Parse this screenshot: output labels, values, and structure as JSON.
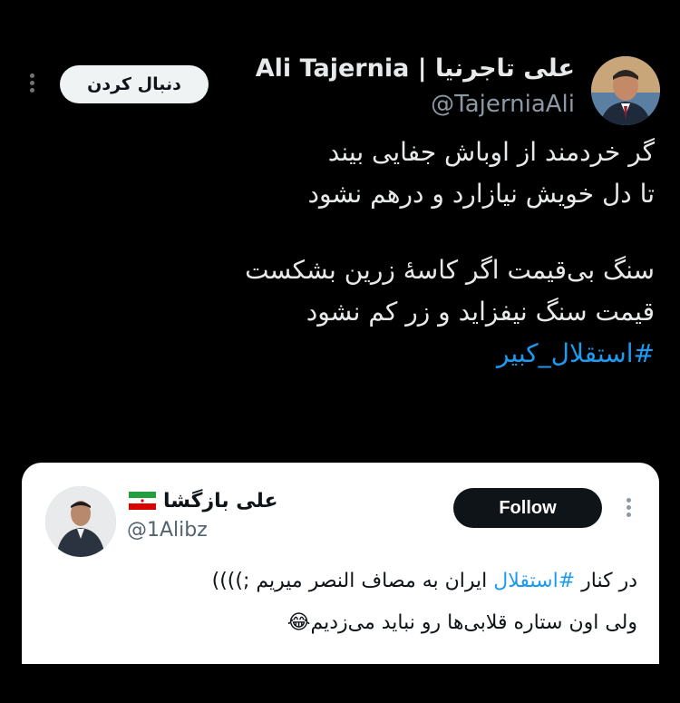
{
  "tweet": {
    "display_name": "Ali Tajernia | علی تاجرنیا",
    "handle": "@TajerniaAli",
    "follow_label": "دنبال کردن",
    "text_lines": [
      "گر خردمند از اوباش جفایی بیند",
      "تا دل خویش نیازارد و درهم نشود",
      "",
      "سنگ بی‌قیمت اگر کاسهٔ زرین بشکست",
      "قیمت سنگ نیفزاید و زر کم نشود"
    ],
    "hashtag": "#استقلال_کبیر"
  },
  "quoted": {
    "display_name": "علی بازگشا",
    "handle": "@1Alibz",
    "follow_label": "Follow",
    "line1_prefix": "در کنار ",
    "line1_hashtag": "#استقلال",
    "line1_suffix": " ایران به مصاف النصر میریم ;))))",
    "line2": "ولی اون ستاره قلابی‌ها رو نباید می‌زدیم😂"
  },
  "colors": {
    "background": "#000000",
    "text": "#e7e9ea",
    "muted": "#8b98a5",
    "link": "#1d9bf0"
  },
  "icons": [
    "more-icon",
    "iran-flag-icon",
    "avatar"
  ]
}
